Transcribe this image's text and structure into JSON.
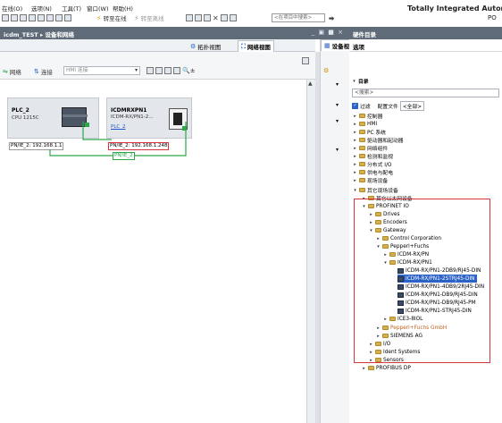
{
  "menubar": {
    "items": [
      "在线(O)",
      "选项(N)",
      "工具(T)",
      "窗口(W)",
      "帮助(H)"
    ],
    "toolbar_go_online": "转至在线",
    "toolbar_go_offline": "转至离线",
    "search_placeholder": "<在项目中搜索>",
    "brand": "Totally Integrated Automa",
    "brand_sub": "PO"
  },
  "window": {
    "title": "icdm_TEST ▸ 设备和网络",
    "controls": "_ ▣ ■ ×"
  },
  "right_window": {
    "title": "硬件目录"
  },
  "views": {
    "topology": "拓扑视图",
    "network": "网络视图",
    "device": "设备视图"
  },
  "netbar": {
    "network_label": "网络",
    "connections_label": "连接",
    "connection_type": "HMI 连接"
  },
  "devices": [
    {
      "name": "PLC_2",
      "model": "CPU 1215C",
      "port": "PN/IE_2: 192.168.1.1"
    },
    {
      "name": "ICDMRXPN1",
      "model": "ICDM-RX/PN1-2...",
      "link": "PLC_2",
      "port": "PN/IE_2: 192.168.1.248",
      "subnet": "PN/IE_2"
    }
  ],
  "options": {
    "title": "选项"
  },
  "catalog": {
    "title": "目录",
    "search": "<搜索>",
    "filter_label": "过滤",
    "profile_label": "配置文件",
    "profile_value": "<全部>",
    "items": [
      {
        "label": "控制器"
      },
      {
        "label": "HMI"
      },
      {
        "label": "PC 系统"
      },
      {
        "label": "驱动器和起动器"
      },
      {
        "label": "网络组件"
      },
      {
        "label": "检测和监视"
      },
      {
        "label": "分布式 I/O"
      },
      {
        "label": "供电与配电"
      },
      {
        "label": "现场设备"
      },
      {
        "label": "其它现场设备"
      },
      {
        "label": "其它以太网设备"
      },
      {
        "label": "PROFINET IO"
      },
      {
        "label": "Drives"
      },
      {
        "label": "Encoders"
      },
      {
        "label": "Gateway"
      },
      {
        "label": "Control Corporation"
      },
      {
        "label": "Pepperl+Fuchs"
      },
      {
        "label": "ICDM-RX/PN"
      },
      {
        "label": "ICDM-RX/PN1"
      },
      {
        "label": "ICDM-RX/PN1-2DB9/RJ45-DIN"
      },
      {
        "label": "ICDM-RX/PN1-2STRJ45-DIN"
      },
      {
        "label": "ICDM-RX/PN1-4DB9/2RJ45-DIN"
      },
      {
        "label": "ICDM-RX/PN1-DB9/RJ45-DIN"
      },
      {
        "label": "ICDM-RX/PN1-DB9/RJ45-PM"
      },
      {
        "label": "ICDM-RX/PN1-STRJ45-DIN"
      },
      {
        "label": "ICE3-8IOL"
      },
      {
        "label": "Pepperl+Fuchs GmbH"
      },
      {
        "label": "SIEMENS AG"
      },
      {
        "label": "I/O"
      },
      {
        "label": "Ident Systems"
      },
      {
        "label": "Sensors"
      },
      {
        "label": "PROFIBUS DP"
      }
    ]
  },
  "colors": {
    "accent": "#2a62c8",
    "highlight": "#d8323a",
    "subnet": "#2aa84a",
    "titlebar": "#5f6b78"
  }
}
